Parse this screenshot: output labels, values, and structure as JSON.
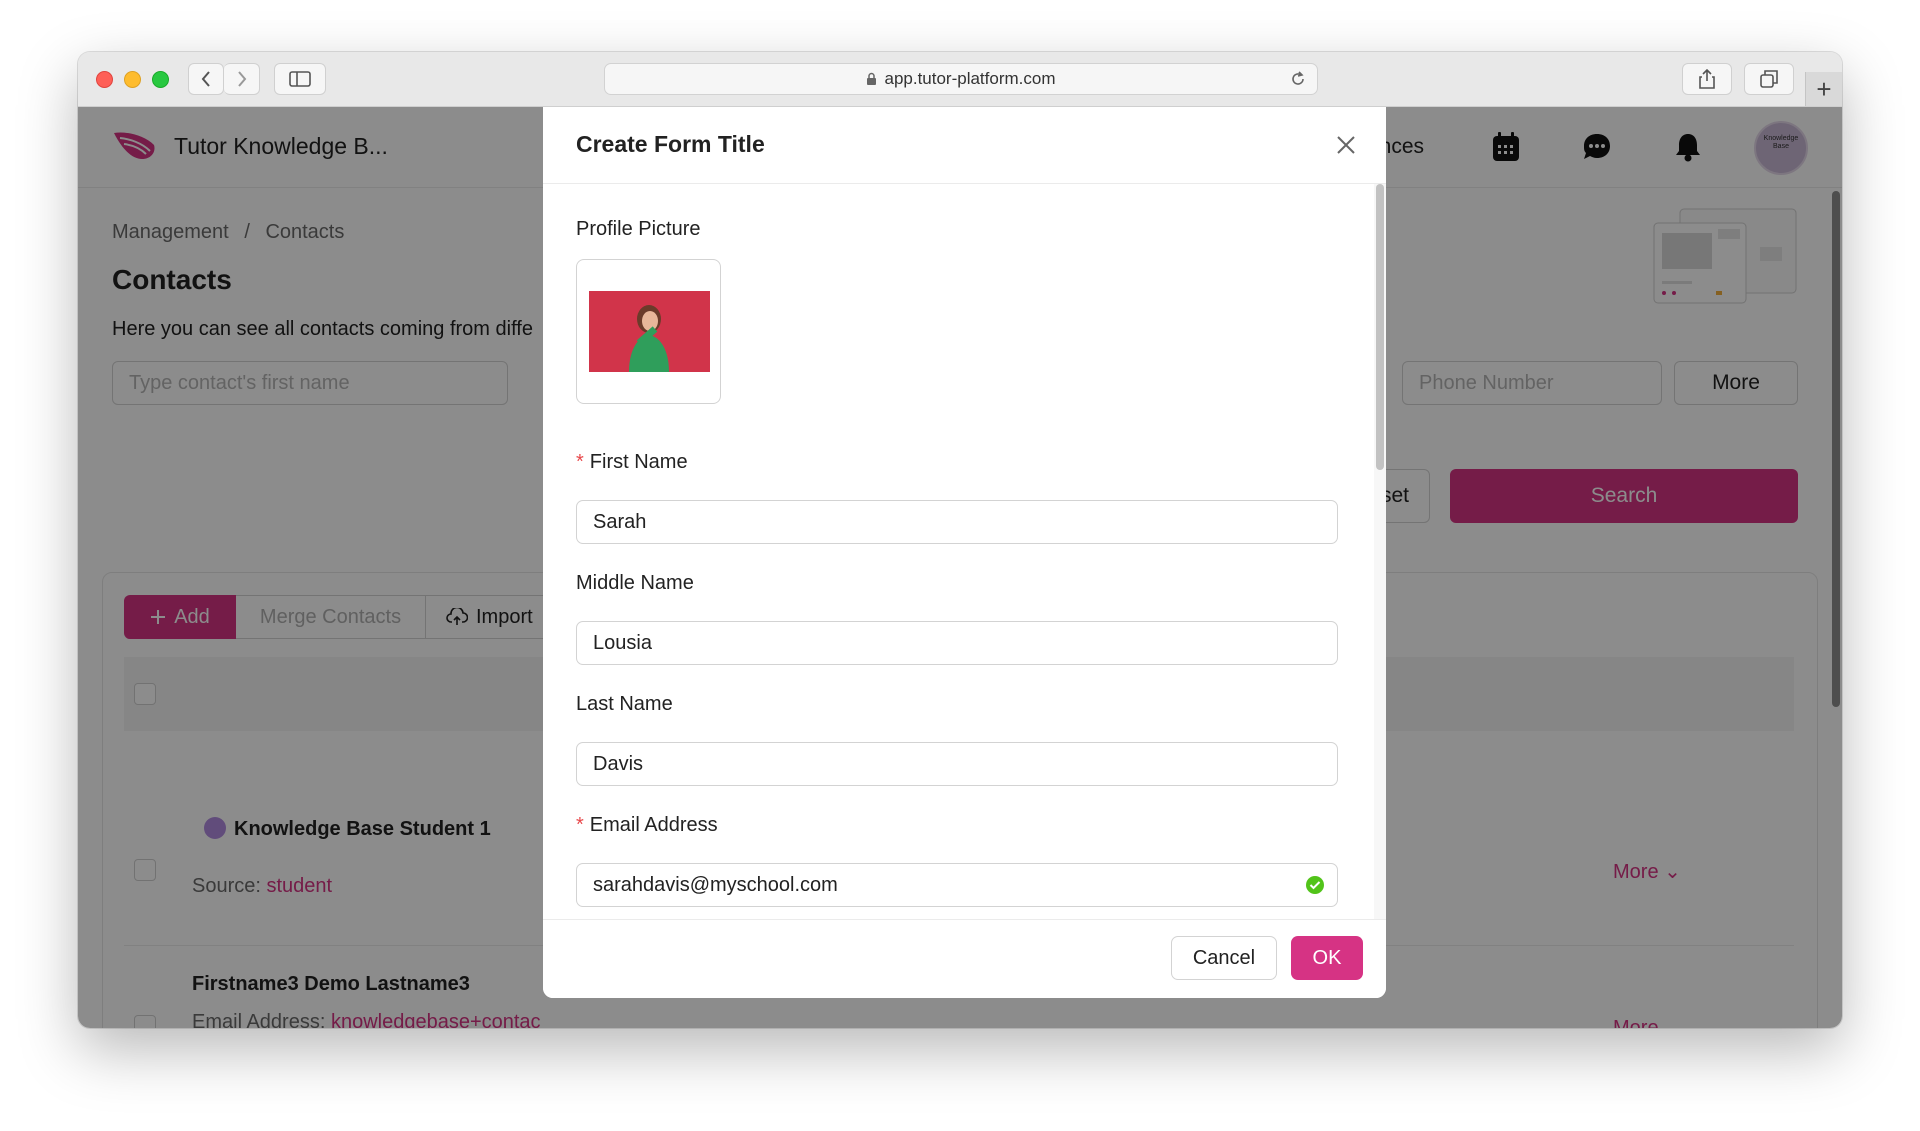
{
  "browser": {
    "url": "app.tutor-platform.com"
  },
  "app": {
    "name": "Tutor Knowledge B...",
    "nav_partial": "ances",
    "avatar_text": "Knowledge Base"
  },
  "breadcrumb": {
    "parent": "Management",
    "separator": "/",
    "current": "Contacts"
  },
  "page": {
    "title": "Contacts",
    "description": "Here you can see all contacts coming from diffe",
    "search_placeholder": "Type contact's first name",
    "phone_placeholder": "Phone Number",
    "more_label": "More",
    "reset_label": "set",
    "search_label": "Search"
  },
  "toolbar": {
    "add_label": "Add",
    "merge_label": "Merge Contacts",
    "import_label": "Import"
  },
  "rows": [
    {
      "name": "Knowledge Base Student 1",
      "meta_label": "Source:",
      "meta_value": "student",
      "more": "More"
    },
    {
      "name": "Firstname3 Demo Lastname3",
      "meta_label": "Email Address:",
      "meta_value": "knowledgebase+contac",
      "more": "More"
    }
  ],
  "modal": {
    "title": "Create Form Title",
    "profile_label": "Profile Picture",
    "first_name_label": "First Name",
    "first_name_value": "Sarah",
    "middle_name_label": "Middle Name",
    "middle_name_value": "Lousia",
    "last_name_label": "Last Name",
    "last_name_value": "Davis",
    "email_label": "Email Address",
    "email_value": "sarahdavis@myschool.com",
    "required_marker": "*",
    "cancel_label": "Cancel",
    "ok_label": "OK"
  },
  "colors": {
    "accent": "#d63384",
    "required": "#e8484b",
    "valid": "#52c41a"
  }
}
